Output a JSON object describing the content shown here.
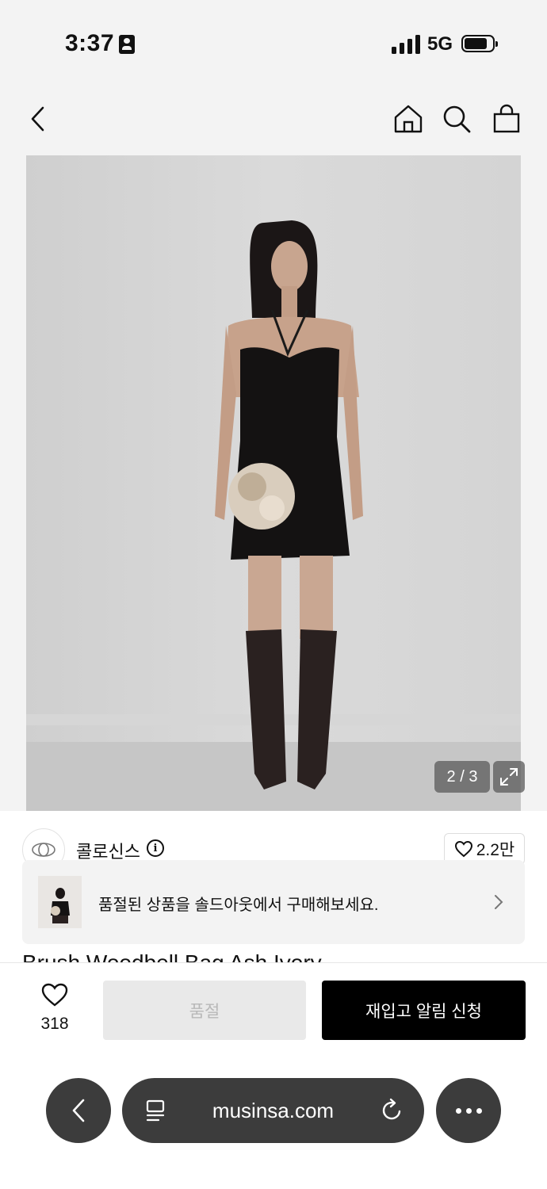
{
  "status_bar": {
    "time": "3:37",
    "network": "5G"
  },
  "icons": {
    "back": "chevron-left-icon",
    "home": "home-icon",
    "search": "search-icon",
    "cart": "shopping-bag-icon",
    "expand": "expand-icon",
    "info": "info-icon",
    "heart": "heart-icon",
    "reader": "reader-icon",
    "reload": "reload-icon",
    "more": "more-icon"
  },
  "gallery": {
    "counter": "2 / 3",
    "current": 2,
    "total": 3
  },
  "brand": {
    "name": "콜로신스",
    "likes": "2.2만",
    "info_glyph": "i"
  },
  "soldout_banner": {
    "text": "품절된 상품을 솔드아웃에서 구매해보세요."
  },
  "product": {
    "title": "Brush Woodbell Bag Ash Ivory"
  },
  "purchase_bar": {
    "wish_count": "318",
    "soldout_label": "품절",
    "restock_label": "재입고 알림 신청"
  },
  "browser": {
    "url": "musinsa.com"
  },
  "colors": {
    "primary_button": "#000000",
    "disabled_button": "#e9e9e9",
    "browser_pill": "#3c3c3c"
  }
}
